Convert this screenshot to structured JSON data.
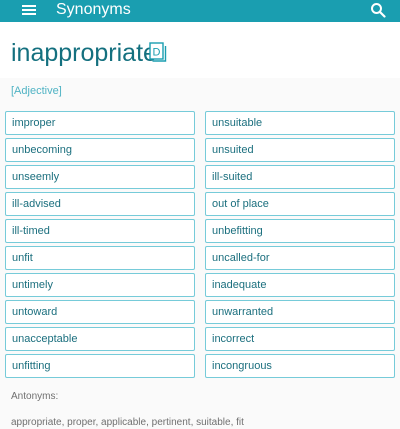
{
  "app_bar": {
    "title": "Synonyms",
    "menu_icon": "hamburger-menu-icon",
    "search_icon": "search-icon",
    "background_color": "#1a9eb0"
  },
  "word": {
    "title": "inappropriate",
    "dictionary_icon": "dictionary-icon",
    "dictionary_icon_letter": "D"
  },
  "part_of_speech": "[Adjective]",
  "synonyms": {
    "left": [
      "improper",
      "unbecoming",
      "unseemly",
      "ill-advised",
      "ill-timed",
      "unfit",
      "untimely",
      "untoward",
      "unacceptable",
      "unfitting"
    ],
    "right": [
      "unsuitable",
      "unsuited",
      "ill-suited",
      "out of place",
      "unbefitting",
      "uncalled-for",
      "inadequate",
      "unwarranted",
      "incorrect",
      "incongruous"
    ]
  },
  "antonyms": {
    "heading": "Antonyms:",
    "list": "appropriate, proper, applicable, pertinent, suitable, fit"
  },
  "colors": {
    "accent": "#1a9eb0",
    "word_text": "#14707f",
    "box_border": "#76cbd9",
    "label_text": "#4fb3c4"
  }
}
